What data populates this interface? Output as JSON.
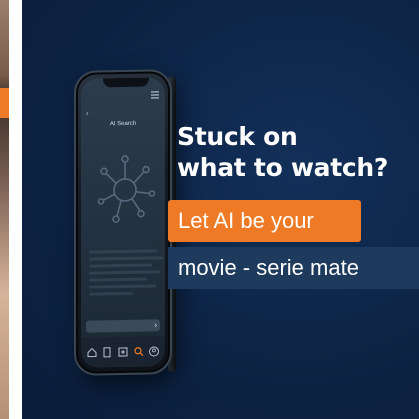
{
  "phone_screen": {
    "title": "AI Search",
    "back_glyph": "‹",
    "send_glyph": "›",
    "icons": [
      "menu-icon",
      "ai-network-icon",
      "home-icon",
      "document-icon",
      "add-icon",
      "search-icon",
      "profile-icon"
    ]
  },
  "headline": {
    "line1": "Stuck on",
    "line2": "what to watch?"
  },
  "cta": {
    "highlight": "Let AI be your",
    "secondary": "movie - serie mate"
  },
  "colors": {
    "background": "#0d2446",
    "accent_orange": "#ef7a26",
    "secondary_box": "#1e3b5e",
    "text": "#ffffff"
  }
}
